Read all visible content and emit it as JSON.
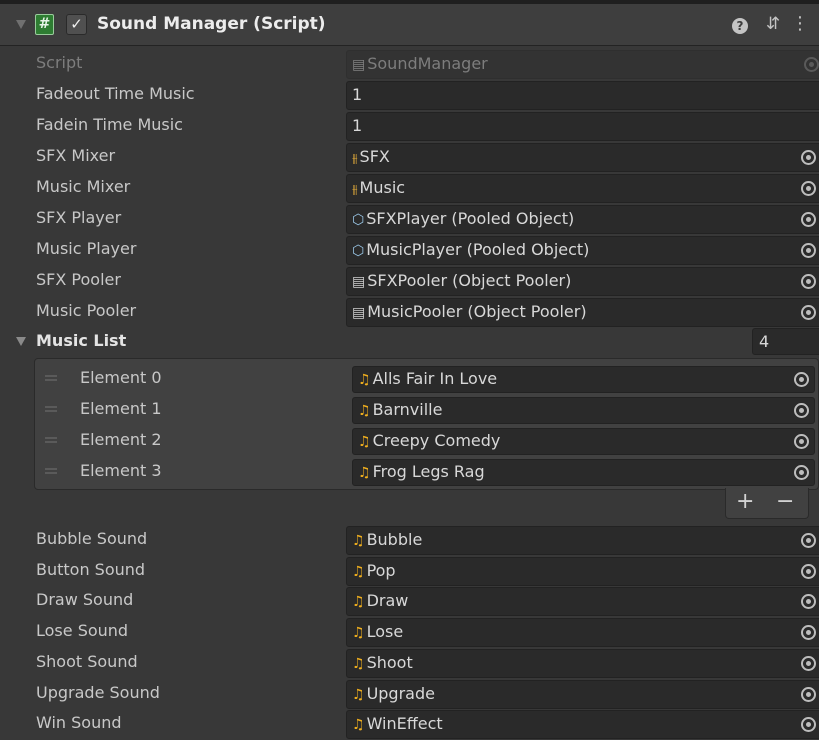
{
  "header": {
    "title": "Sound Manager (Script)",
    "enabled_check": "✓",
    "script_icon_glyph": "#",
    "help_glyph": "?",
    "preset_glyph": "⇵",
    "more_glyph": "⋮"
  },
  "script_row": {
    "label": "Script",
    "value": "SoundManager",
    "icon": "script-icon",
    "disabled": true
  },
  "properties": [
    {
      "label": "Fadeout Time Music",
      "value": "1",
      "icon": null
    },
    {
      "label": "Fadein Time Music",
      "value": "1",
      "icon": null
    },
    {
      "label": "SFX Mixer",
      "value": "SFX",
      "icon": "audio-mixer-icon"
    },
    {
      "label": "Music Mixer",
      "value": "Music",
      "icon": "audio-mixer-icon"
    },
    {
      "label": "SFX Player",
      "value": "SFXPlayer (Pooled Object)",
      "icon": "prefab-icon"
    },
    {
      "label": "Music Player",
      "value": "MusicPlayer (Pooled Object)",
      "icon": "prefab-icon"
    },
    {
      "label": "SFX Pooler",
      "value": "SFXPooler (Object Pooler)",
      "icon": "script-icon"
    },
    {
      "label": "Music Pooler",
      "value": "MusicPooler (Object Pooler)",
      "icon": "script-icon"
    }
  ],
  "music_list": {
    "label": "Music List",
    "size": "4",
    "elements": [
      {
        "label": "Element 0",
        "value": "Alls Fair In Love"
      },
      {
        "label": "Element 1",
        "value": "Barnville"
      },
      {
        "label": "Element 2",
        "value": "Creepy Comedy"
      },
      {
        "label": "Element 3",
        "value": "Frog Legs Rag"
      }
    ],
    "add_label": "+",
    "remove_label": "−"
  },
  "sounds": [
    {
      "label": "Bubble Sound",
      "value": "Bubble"
    },
    {
      "label": "Button Sound",
      "value": "Pop"
    },
    {
      "label": "Draw Sound",
      "value": "Draw"
    },
    {
      "label": "Lose Sound",
      "value": "Lose"
    },
    {
      "label": "Shoot Sound",
      "value": "Shoot"
    },
    {
      "label": "Upgrade Sound",
      "value": "Upgrade"
    },
    {
      "label": "Win Sound",
      "value": "WinEffect"
    }
  ],
  "icons": {
    "script-icon": "▤",
    "audio-mixer-icon": "⫵",
    "prefab-icon": "⬡",
    "audio-clip-icon": "♫"
  },
  "colors": {
    "background": "#383838",
    "field": "#2a2a2a",
    "audio_icon": "#f2b01e",
    "mixer_icon": "#e0a93a"
  }
}
